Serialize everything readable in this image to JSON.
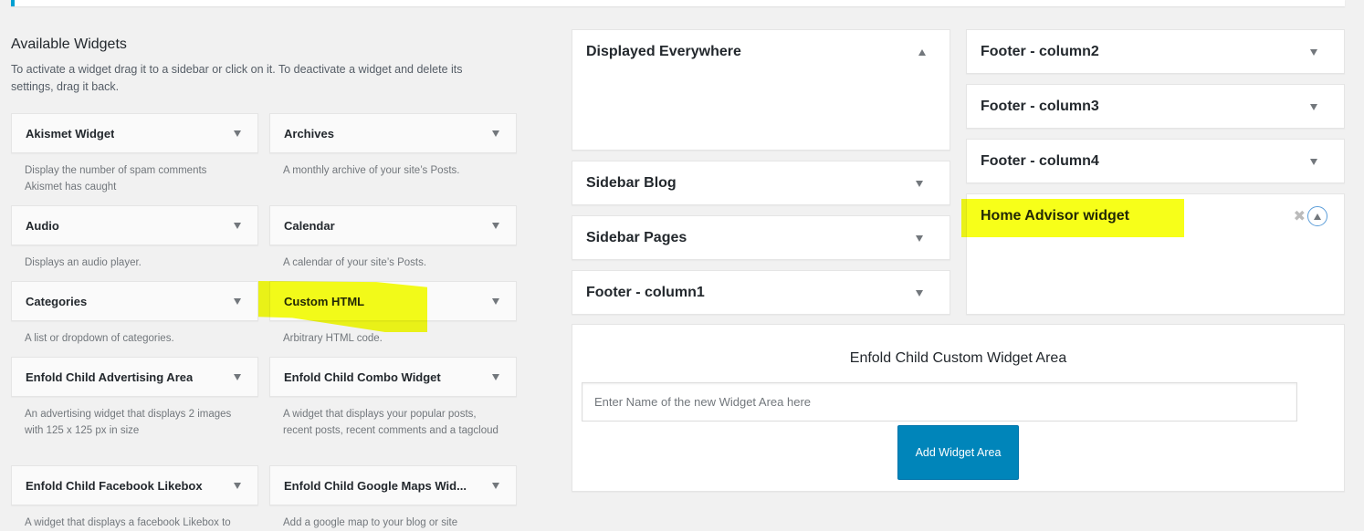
{
  "available_widgets": {
    "title": "Available Widgets",
    "description": "To activate a widget drag it to a sidebar or click on it. To deactivate a widget and delete its settings, drag it back.",
    "widgets": [
      {
        "name": "Akismet Widget",
        "description": "Display the number of spam comments Akismet has caught"
      },
      {
        "name": "Archives",
        "description": "A monthly archive of your site’s Posts."
      },
      {
        "name": "Audio",
        "description": "Displays an audio player."
      },
      {
        "name": "Calendar",
        "description": "A calendar of your site’s Posts."
      },
      {
        "name": "Categories",
        "description": "A list or dropdown of categories."
      },
      {
        "name": "Custom HTML",
        "description": "Arbitrary HTML code.",
        "highlighted": true
      },
      {
        "name": "Enfold Child Advertising Area",
        "description": "An advertising widget that displays 2 images with 125 x 125 px in size"
      },
      {
        "name": "Enfold Child Combo Widget",
        "description": "A widget that displays your popular posts, recent posts, recent comments and a tagcloud"
      },
      {
        "name": "Enfold Child Facebook Likebox",
        "description": "A widget that displays a facebook Likebox to"
      },
      {
        "name": "Enfold Child Google Maps Wid...",
        "description": "Add a google map to your blog or site"
      }
    ]
  },
  "sidebars_left": [
    {
      "name": "Displayed Everywhere",
      "expanded": true
    },
    {
      "name": "Sidebar Blog",
      "expanded": false
    },
    {
      "name": "Sidebar Pages",
      "expanded": false
    },
    {
      "name": "Footer - column1",
      "expanded": false
    }
  ],
  "sidebars_right": [
    {
      "name": "Footer - column2",
      "expanded": false
    },
    {
      "name": "Footer - column3",
      "expanded": false
    },
    {
      "name": "Footer - column4",
      "expanded": false
    },
    {
      "name": "Home Advisor widget",
      "expanded": true,
      "highlighted": true
    }
  ],
  "custom_widget_area": {
    "title": "Enfold Child Custom Widget Area",
    "input_placeholder": "Enter Name of the new Widget Area here",
    "input_value": "",
    "button_label": "Add Widget Area"
  },
  "colors": {
    "accent": "#0085ba",
    "highlight": "#f6ff00",
    "background": "#f1f1f1"
  }
}
